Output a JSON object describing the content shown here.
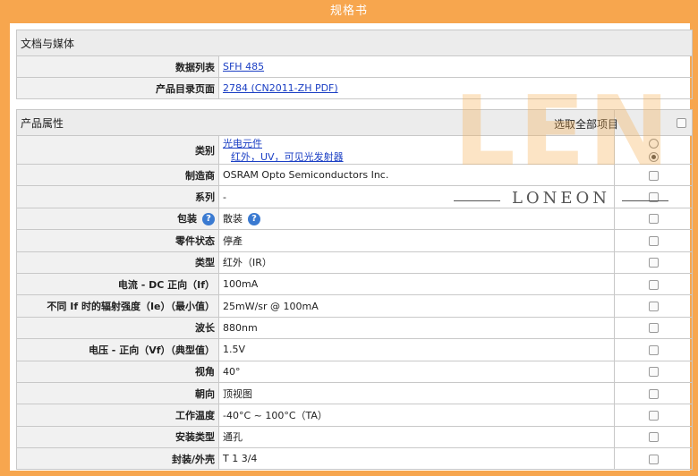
{
  "page": {
    "title": "规格书",
    "accent": "#f7a64e"
  },
  "docs": {
    "header": "文档与媒体",
    "rows": [
      {
        "label": "数据列表",
        "link": "SFH 485"
      },
      {
        "label": "产品目录页面",
        "link": "2784 (CN2011-ZH PDF)"
      }
    ]
  },
  "attributes": {
    "header": "产品属性",
    "select_all": "选取全部项目",
    "category": {
      "label": "类别",
      "links": [
        "光电元件",
        "红外，UV，可见光发射器"
      ]
    },
    "rows": [
      {
        "label": "制造商",
        "value": "OSRAM Opto Semiconductors Inc."
      },
      {
        "label": "系列",
        "value": "-"
      },
      {
        "label": "包装",
        "value": "散装",
        "label_help": true,
        "value_help": true
      },
      {
        "label": "零件状态",
        "value": "停產"
      },
      {
        "label": "类型",
        "value": "红外（IR）"
      },
      {
        "label": "电流 - DC 正向（If）",
        "value": "100mA"
      },
      {
        "label": "不同 If 时的辐射强度（Ie）（最小值）",
        "value": "25mW/sr @ 100mA"
      },
      {
        "label": "波长",
        "value": "880nm"
      },
      {
        "label": "电压 - 正向（Vf）（典型值）",
        "value": "1.5V"
      },
      {
        "label": "视角",
        "value": "40°"
      },
      {
        "label": "朝向",
        "value": "顶视图"
      },
      {
        "label": "工作温度",
        "value": "-40°C ~ 100°C（TA）"
      },
      {
        "label": "安装类型",
        "value": "通孔"
      },
      {
        "label": "封装/外壳",
        "value": "T 1 3/4"
      }
    ]
  },
  "watermark": {
    "letters": "LEN",
    "brand": "LONEON"
  }
}
